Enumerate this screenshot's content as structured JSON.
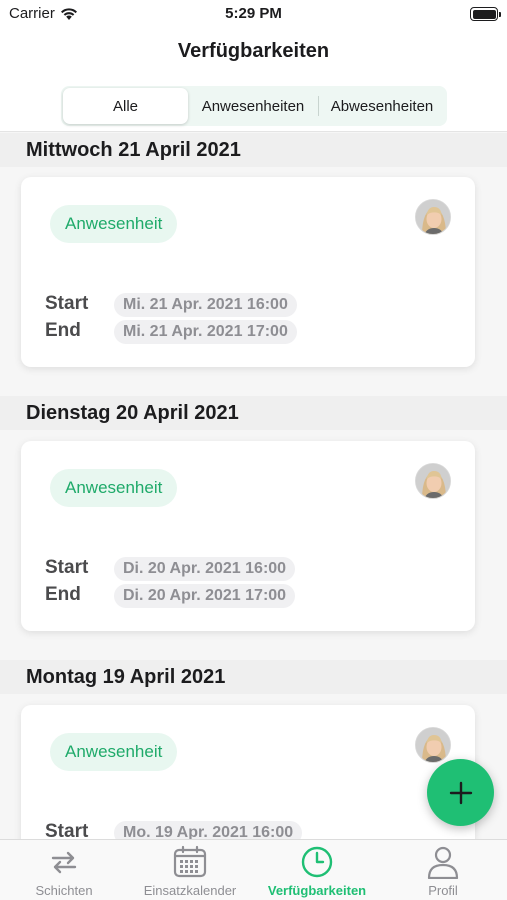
{
  "status_bar": {
    "carrier": "Carrier",
    "time": "5:29 PM"
  },
  "header": {
    "title": "Verfügbarkeiten",
    "segments": [
      "Alle",
      "Anwesenheiten",
      "Abwesenheiten"
    ],
    "selected_segment": "Alle"
  },
  "days": [
    {
      "date": "Mittwoch 21 April 2021",
      "badge": "Anwesenheit",
      "start_label": "Start",
      "start": "Mi. 21 Apr. 2021 16:00",
      "end_label": "End",
      "end": "Mi. 21 Apr. 2021 17:00"
    },
    {
      "date": "Dienstag 20 April 2021",
      "badge": "Anwesenheit",
      "start_label": "Start",
      "start": "Di. 20 Apr. 2021 16:00",
      "end_label": "End",
      "end": "Di. 20 Apr. 2021 17:00"
    },
    {
      "date": "Montag 19 April 2021",
      "badge": "Anwesenheit",
      "start_label": "Start",
      "start": "Mo. 19 Apr. 2021 16:00"
    }
  ],
  "tabs": [
    {
      "label": "Schichten",
      "icon": "swap-arrows-icon"
    },
    {
      "label": "Einsatzkalender",
      "icon": "calendar-icon"
    },
    {
      "label": "Verfügbarkeiten",
      "icon": "clock-icon",
      "active": true
    },
    {
      "label": "Profil",
      "icon": "person-icon"
    }
  ],
  "colors": {
    "accent": "#1fbf74",
    "badge_text": "#1faa6a",
    "badge_bg": "#e8f7f0"
  }
}
